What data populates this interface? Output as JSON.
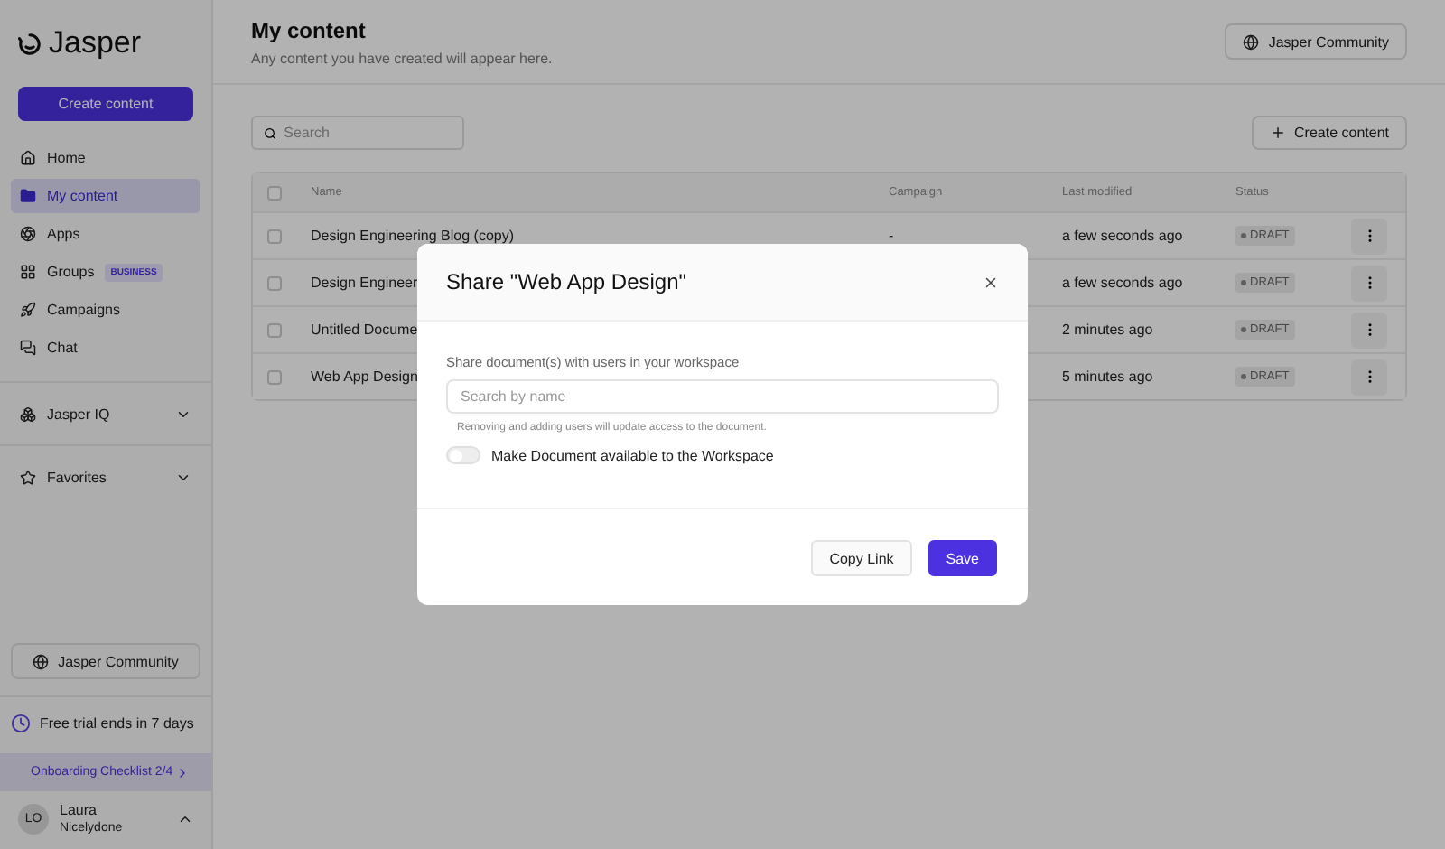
{
  "sidebar": {
    "logo": "Jasper",
    "create_button": "Create content",
    "nav": [
      {
        "label": "Home",
        "selected": false
      },
      {
        "label": "My content",
        "selected": true
      },
      {
        "label": "Apps",
        "selected": false
      },
      {
        "label": "Groups",
        "selected": false,
        "badge": "BUSINESS"
      },
      {
        "label": "Campaigns",
        "selected": false
      },
      {
        "label": "Chat",
        "selected": false
      }
    ],
    "sections": [
      {
        "label": "Jasper IQ",
        "expanded": false
      },
      {
        "label": "Favorites",
        "expanded": false
      }
    ],
    "community_button": "Jasper Community",
    "trial": "Free trial ends in 7 days",
    "onboarding": "Onboarding Checklist 2/4",
    "user": {
      "initials": "LO",
      "name": "Laura",
      "org": "Nicelydone"
    }
  },
  "header": {
    "title": "My content",
    "subtitle": "Any content you have created will appear here.",
    "community_button": "Jasper Community"
  },
  "toolbar": {
    "search": {
      "placeholder": "Search"
    },
    "create_button": "Create content"
  },
  "table": {
    "select_all": {
      "checked": false
    },
    "columns": [
      "Name",
      "Campaign",
      "Last modified",
      "Status"
    ],
    "rows": [
      {
        "checked": false,
        "name": "Design Engineering Blog (copy)",
        "campaign": "-",
        "modified": "a few seconds ago",
        "status": "DRAFT"
      },
      {
        "checked": false,
        "name": "Design Engineer",
        "modified": "a few seconds ago",
        "status": "DRAFT"
      },
      {
        "checked": false,
        "name": "Untitled Docume",
        "modified": "2 minutes ago",
        "status": "DRAFT"
      },
      {
        "checked": false,
        "name": "Web App Design",
        "modified": "5 minutes ago",
        "status": "DRAFT"
      }
    ]
  },
  "dialog": {
    "title": "Share \"Web App Design\"",
    "label": "Share document(s) with users in your workspace",
    "search": {
      "placeholder": "Search by name"
    },
    "hint": "Removing and adding users will update access to the document.",
    "toggle": {
      "label": "Make Document available to the Workspace",
      "on": false
    },
    "buttons": [
      {
        "label": "Copy Link",
        "kind": "secondary"
      },
      {
        "label": "Save",
        "kind": "primary"
      }
    ]
  }
}
